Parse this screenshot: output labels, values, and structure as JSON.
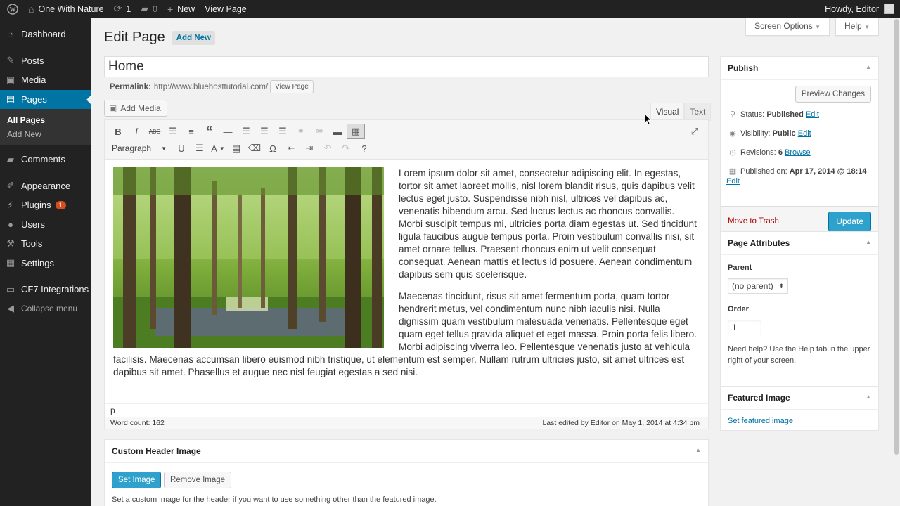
{
  "adminbar": {
    "site_name": "One With Nature",
    "updates_count": "1",
    "comments_count": "0",
    "new_label": "New",
    "view_page_label": "View Page",
    "howdy": "Howdy, Editor"
  },
  "sidebar": {
    "items": [
      {
        "label": "Dashboard",
        "icon": "dashboard-icon"
      },
      {
        "label": "Posts",
        "icon": "pin-icon"
      },
      {
        "label": "Media",
        "icon": "media-icon"
      },
      {
        "label": "Pages",
        "icon": "pages-icon"
      },
      {
        "label": "Comments",
        "icon": "comment-icon"
      },
      {
        "label": "Appearance",
        "icon": "brush-icon"
      },
      {
        "label": "Plugins",
        "icon": "plug-icon",
        "badge": "1"
      },
      {
        "label": "Users",
        "icon": "user-icon"
      },
      {
        "label": "Tools",
        "icon": "wrench-icon"
      },
      {
        "label": "Settings",
        "icon": "settings-icon"
      },
      {
        "label": "CF7 Integrations",
        "icon": "form-icon"
      },
      {
        "label": "Collapse menu",
        "icon": "collapse-icon"
      }
    ],
    "pages_submenu": [
      "All Pages",
      "Add New"
    ]
  },
  "header": {
    "screen_options": "Screen Options",
    "help": "Help",
    "title": "Edit Page",
    "add_new": "Add New"
  },
  "editor": {
    "title_value": "Home",
    "permalink_label": "Permalink:",
    "permalink_url": "http://www.bluehosttutorial.com/",
    "view_page_btn": "View Page",
    "add_media": "Add Media",
    "tab_visual": "Visual",
    "tab_text": "Text",
    "format_select": "Paragraph",
    "paragraph1": "Lorem ipsum dolor sit amet, consectetur adipiscing elit. In egestas, tortor sit amet laoreet mollis, nisl lorem blandit risus, quis dapibus velit lectus eget justo. Suspendisse nibh nisl, ultrices vel dapibus ac, venenatis bibendum arcu. Sed luctus lectus ac rhoncus convallis. Morbi suscipit tempus mi, ultricies porta diam egestas ut. Sed tincidunt ligula faucibus augue tempus porta. Proin vestibulum convallis nisi, sit amet ornare tellus. Praesent rhoncus enim ut velit consequat consequat. Aenean mattis et lectus id posuere. Aenean condimentum dapibus sem quis scelerisque.",
    "paragraph2": "Maecenas tincidunt, risus sit amet fermentum porta, quam tortor hendrerit metus, vel condimentum nunc nibh iaculis nisi. Nulla dignissim quam vestibulum malesuada venenatis. Pellentesque eget quam eget tellus gravida aliquet et eget massa. Proin porta felis libero. Morbi adipiscing viverra leo. Pellentesque venenatis justo at vehicula facilisis. Maecenas accumsan libero euismod nibh tristique, ut elementum est semper. Nullam rutrum ultricies justo, sit amet ultrices est dapibus sit amet. Phasellus et augue nec nisl feugiat egestas a sed nisi.",
    "path": "p",
    "word_count": "Word count: 162",
    "last_edited": "Last edited by Editor on May 1, 2014 at 4:34 pm"
  },
  "custom_header": {
    "title": "Custom Header Image",
    "set_image": "Set Image",
    "remove_image": "Remove Image",
    "description": "Set a custom image for the header if you want to use something other than the featured image."
  },
  "publish": {
    "title": "Publish",
    "preview": "Preview Changes",
    "status_label": "Status:",
    "status_value": "Published",
    "visibility_label": "Visibility:",
    "visibility_value": "Public",
    "revisions_label": "Revisions:",
    "revisions_value": "6",
    "browse": "Browse",
    "published_on_label": "Published on:",
    "published_on_value": "Apr 17, 2014 @ 18:14",
    "edit": "Edit",
    "move_to_trash": "Move to Trash",
    "update": "Update"
  },
  "page_attributes": {
    "title": "Page Attributes",
    "parent_label": "Parent",
    "parent_value": "(no parent)",
    "order_label": "Order",
    "order_value": "1",
    "help_text": "Need help? Use the Help tab in the upper right of your screen."
  },
  "featured_image": {
    "title": "Featured Image",
    "set_link": "Set featured image"
  },
  "colors": {
    "admin_dark": "#222222",
    "accent_blue": "#0074a2",
    "button_blue": "#2ea2cc",
    "trash_red": "#aa0000"
  }
}
